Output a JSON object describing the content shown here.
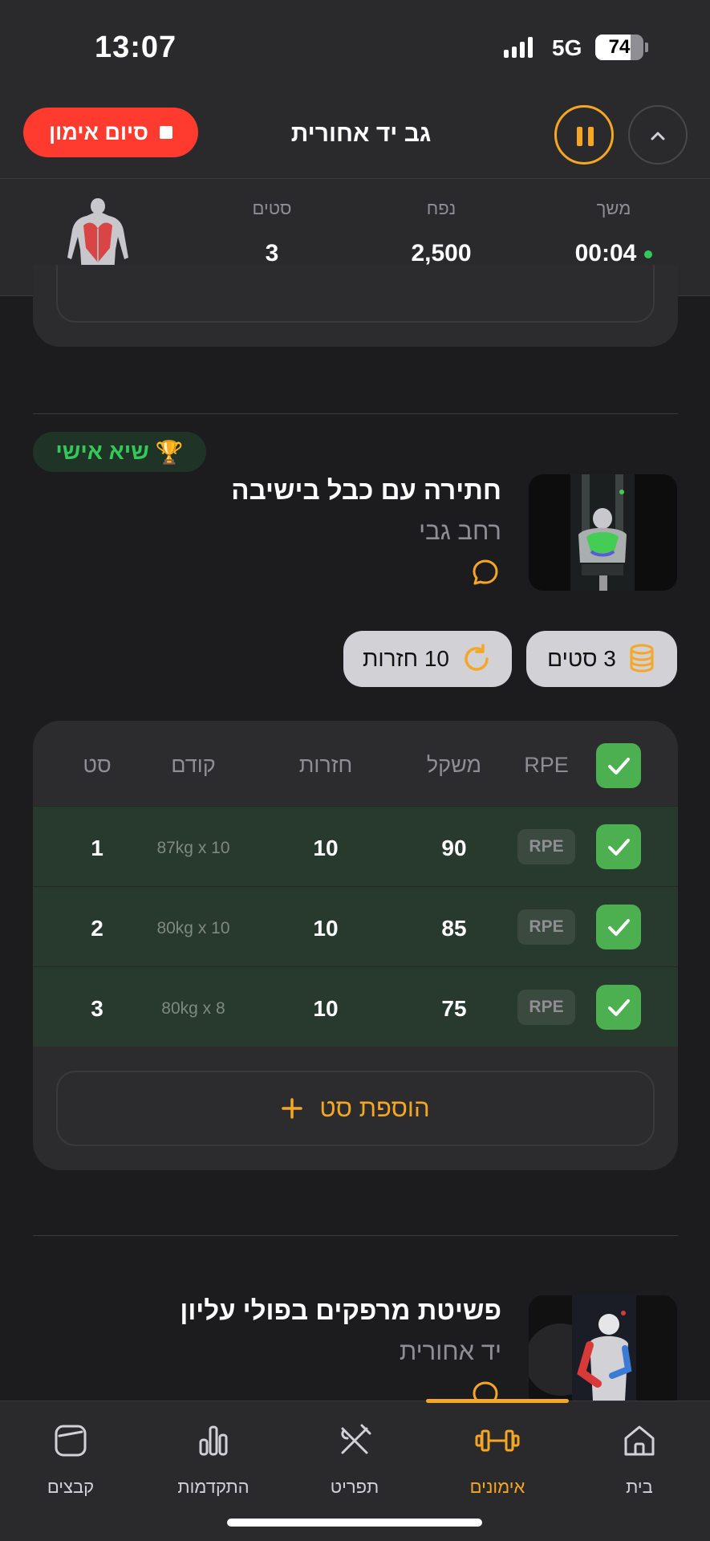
{
  "status_bar": {
    "time": "13:07",
    "network": "5G",
    "battery": "74",
    "battery_level": 0.74
  },
  "header": {
    "title": "גב יד אחורית",
    "end_workout_label": "סיום אימון"
  },
  "stats": {
    "duration_label": "משך",
    "duration_value": "00:04",
    "volume_label": "נפח",
    "volume_value": "2,500",
    "sets_label": "סטים",
    "sets_value": "3"
  },
  "exercise1": {
    "pr_badge": "שיא אישי",
    "name": "חתירה עם כבל בישיבה",
    "muscle": "רחב גבי",
    "sets_pill": "3 סטים",
    "reps_pill": "10 חזרות",
    "table": {
      "headers": {
        "set": "סט",
        "previous": "קודם",
        "reps": "חזרות",
        "weight": "משקל",
        "rpe": "RPE"
      },
      "rows": [
        {
          "set": "1",
          "previous": "87kg x 10",
          "reps": "10",
          "weight": "90",
          "rpe": "RPE"
        },
        {
          "set": "2",
          "previous": "80kg x 10",
          "reps": "10",
          "weight": "85",
          "rpe": "RPE"
        },
        {
          "set": "3",
          "previous": "80kg x 8",
          "reps": "10",
          "weight": "75",
          "rpe": "RPE"
        }
      ]
    },
    "add_set_label": "הוספת סט"
  },
  "exercise2": {
    "name": "פשיטת מרפקים בפולי עליון",
    "muscle": "יד אחורית"
  },
  "tabs": [
    {
      "label": "קבצים",
      "icon": "folder-icon"
    },
    {
      "label": "התקדמות",
      "icon": "bar-chart-icon"
    },
    {
      "label": "תפריט",
      "icon": "fork-knife-icon"
    },
    {
      "label": "אימונים",
      "icon": "dumbbell-icon",
      "active": true
    },
    {
      "label": "בית",
      "icon": "home-icon"
    }
  ],
  "colors": {
    "accent": "#f5a623",
    "danger": "#ff3b30",
    "success": "#4caf50",
    "pr_green": "#34c759"
  }
}
